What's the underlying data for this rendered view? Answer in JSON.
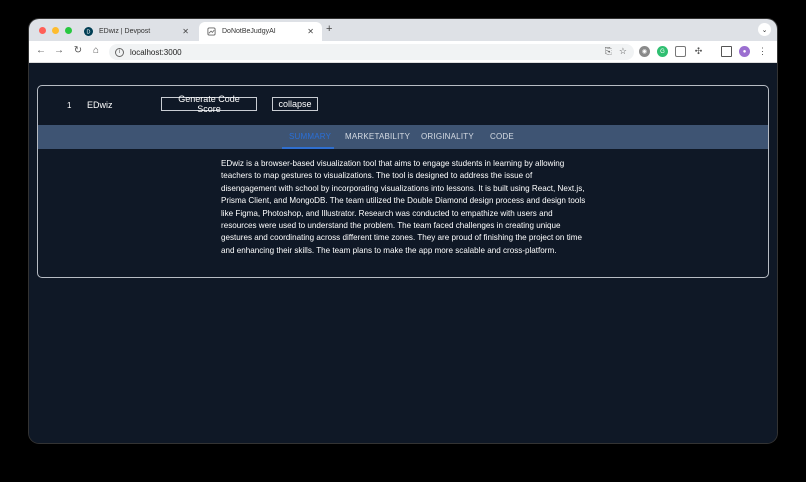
{
  "browser": {
    "tabs": [
      {
        "title": "EDwiz | Devpost",
        "icon": "devpost-icon"
      },
      {
        "title": "DoNotBeJudgyAI",
        "icon": "page-icon"
      }
    ],
    "new_tab_label": "+",
    "url": "localhost:3000",
    "colors": {
      "close": "#ff5f57",
      "minimize": "#febc2e",
      "maximize": "#28c840"
    }
  },
  "project": {
    "rank": "1",
    "name": "EDwiz",
    "generate_label": "Generate Code Score",
    "collapse_label": "collapse",
    "tabs": [
      "SUMMARY",
      "MARKETABILITY",
      "ORIGINALITY",
      "CODE"
    ],
    "selected_tab": "SUMMARY",
    "summary": "EDwiz is a browser-based visualization tool that aims to engage students in learning by allowing teachers to map gestures to visualizations. The tool is designed to address the issue of disengagement with school by incorporating visualizations into lessons. It is built using React, Next.js, Prisma Client, and MongoDB. The team utilized the Double Diamond design process and design tools like Figma, Photoshop, and Illustrator. Research was conducted to empathize with users and resources were used to understand the problem. The team faced challenges in creating unique gestures and coordinating across different time zones. They are proud of finishing the project on time and enhancing their skills. The team plans to make the app more scalable and cross-platform."
  },
  "theme": {
    "background": "#0f1826",
    "tab_bar": "#3e5473",
    "accent": "#2a6fd6"
  }
}
